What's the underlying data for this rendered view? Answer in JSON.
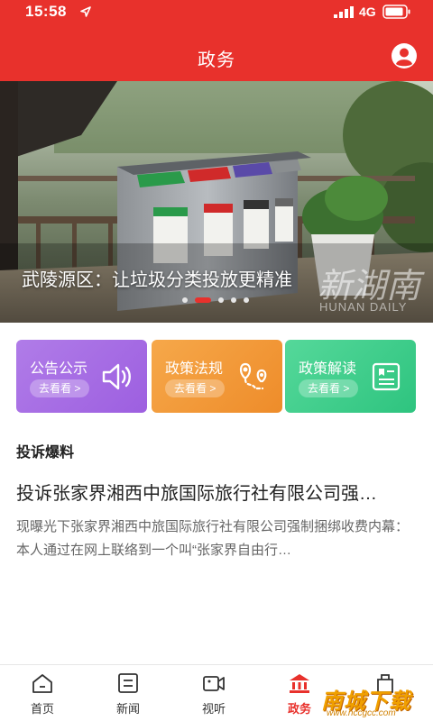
{
  "status_bar": {
    "time": "15:58",
    "network": "4G"
  },
  "header": {
    "title": "政务"
  },
  "banner": {
    "caption": "武陵源区：让垃圾分类投放更精准",
    "watermark": "新湖南",
    "watermark_sub": "HUNAN DAILY",
    "slide_count": 5,
    "active_slide": 2
  },
  "cards": [
    {
      "title": "公告公示",
      "button": "去看看 >",
      "icon": "speaker-icon"
    },
    {
      "title": "政策法规",
      "button": "去看看 >",
      "icon": "map-pin-route-icon"
    },
    {
      "title": "政策解读",
      "button": "去看看 >",
      "icon": "reading-list-icon"
    }
  ],
  "complaint": {
    "section_title": "投诉爆料",
    "article_title": "投诉张家界湘西中旅国际旅行社有限公司强…",
    "article_summary": "现曝光下张家界湘西中旅国际旅行社有限公司强制捆绑收费内幕：　本人通过在网上联络到一个叫“张家界自由行…"
  },
  "bottom_nav": {
    "items": [
      {
        "label": "首页",
        "icon": "home-icon"
      },
      {
        "label": "新闻",
        "icon": "news-icon"
      },
      {
        "label": "视听",
        "icon": "video-icon"
      },
      {
        "label": "政务",
        "icon": "government-icon"
      },
      {
        "label": "",
        "icon": "shop-icon"
      }
    ],
    "active": "政务"
  },
  "site_mark": {
    "text": "南城下载",
    "url": "www.nccgcc.com"
  },
  "colors": {
    "brand_red": "#e8312c"
  }
}
